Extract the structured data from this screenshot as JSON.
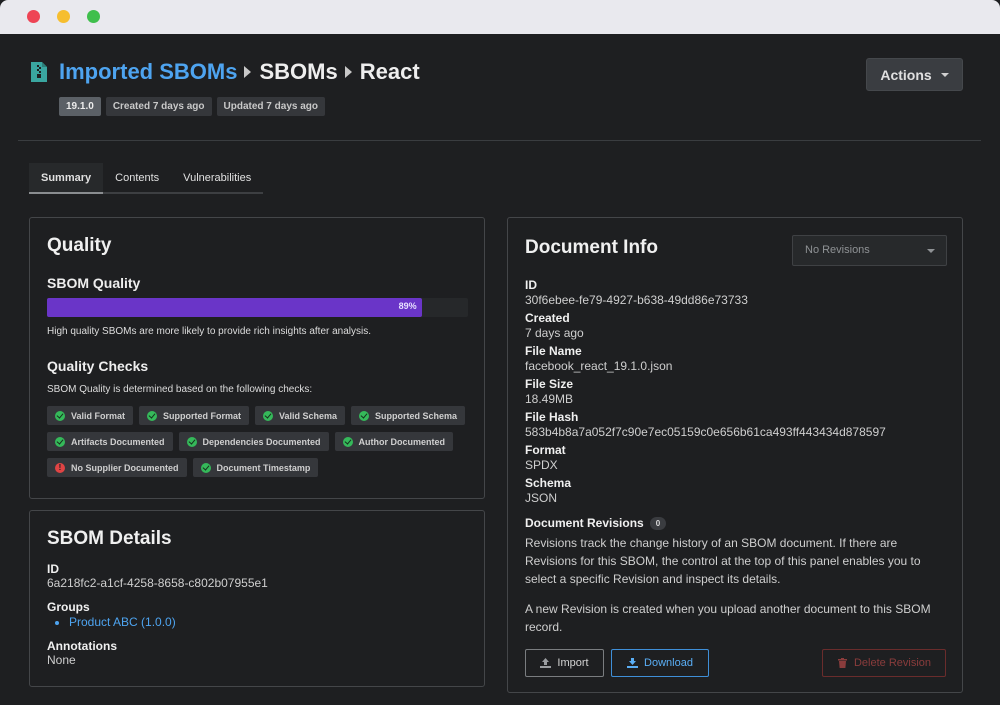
{
  "window": {
    "controls": [
      "close",
      "minimize",
      "maximize"
    ]
  },
  "header": {
    "breadcrumb": [
      "Imported SBOMs",
      "SBOMs",
      "React"
    ],
    "version": "19.1.0",
    "created": "Created 7 days ago",
    "updated": "Updated 7 days ago",
    "actions_label": "Actions"
  },
  "tabs": [
    "Summary",
    "Contents",
    "Vulnerabilities"
  ],
  "quality": {
    "title": "Quality",
    "subtitle": "SBOM Quality",
    "score_fraction": 0.89,
    "score_label": "89%",
    "note": "High quality SBOMs are more likely to provide rich insights after analysis.",
    "checks_title": "Quality Checks",
    "checks_desc": "SBOM Quality is determined based on the following checks:",
    "checks": [
      {
        "label": "Valid Format",
        "status": "pass"
      },
      {
        "label": "Supported Format",
        "status": "pass"
      },
      {
        "label": "Valid Schema",
        "status": "pass"
      },
      {
        "label": "Supported Schema",
        "status": "pass"
      },
      {
        "label": "Artifacts Documented",
        "status": "pass"
      },
      {
        "label": "Dependencies Documented",
        "status": "pass"
      },
      {
        "label": "Author Documented",
        "status": "pass"
      },
      {
        "label": "No Supplier Documented",
        "status": "fail"
      },
      {
        "label": "Document Timestamp",
        "status": "pass"
      }
    ]
  },
  "details": {
    "title": "SBOM Details",
    "id_label": "ID",
    "id": "6a218fc2-a1cf-4258-8658-c802b07955e1",
    "groups_label": "Groups",
    "groups": [
      "Product ABC (1.0.0)"
    ],
    "annotations_label": "Annotations",
    "annotations": "None"
  },
  "docinfo": {
    "title": "Document Info",
    "revision_select": "No Revisions",
    "fields": [
      {
        "label": "ID",
        "value": "30f6ebee-fe79-4927-b638-49dd86e73733"
      },
      {
        "label": "Created",
        "value": "7 days ago"
      },
      {
        "label": "File Name",
        "value": "facebook_react_19.1.0.json"
      },
      {
        "label": "File Size",
        "value": "18.49MB"
      },
      {
        "label": "File Hash",
        "value": "583b4b8a7a052f7c90e7ec05159c0e656b61ca493ff443434d878597"
      },
      {
        "label": "Format",
        "value": "SPDX"
      },
      {
        "label": "Schema",
        "value": "JSON"
      }
    ],
    "revisions_label": "Document Revisions",
    "revisions_count": "0",
    "revisions_p1": "Revisions track the change history of an SBOM document. If there are Revisions for this SBOM, the control at the top of this panel enables you to select a specific Revision and inspect its details.",
    "revisions_p2": "A new Revision is created when you upload another document to this SBOM record.",
    "import_label": "Import",
    "download_label": "Download",
    "delete_label": "Delete Revision"
  },
  "colors": {
    "accent": "#4ea4f0",
    "progress": "#6a35c8",
    "pass": "#35b95a",
    "fail": "#e04444"
  }
}
